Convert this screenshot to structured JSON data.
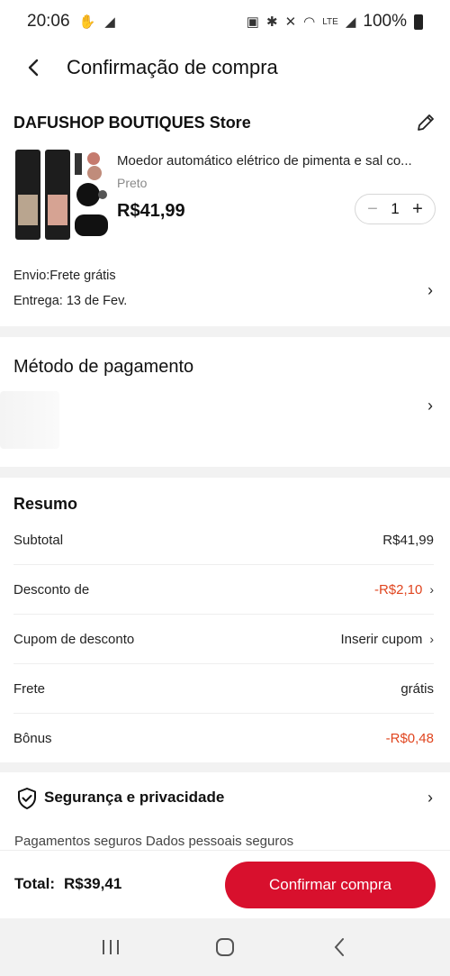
{
  "status_bar": {
    "time": "20:06",
    "battery_text": "100%"
  },
  "header": {
    "back_icon": "back-arrow-icon",
    "title": "Confirmação de compra"
  },
  "store": {
    "name": "DAFUSHOP BOUTIQUES Store",
    "edit_icon": "pencil-icon",
    "product": {
      "title": "Moedor automático elétrico de pimenta e sal co...",
      "variant": "Preto",
      "price": "R$41,99",
      "quantity": "1"
    },
    "shipping": {
      "line1": "Envio:Frete grátis",
      "line2": "Entrega: 13 de Fev."
    }
  },
  "payment": {
    "title": "Método de pagamento"
  },
  "summary": {
    "title": "Resumo",
    "rows": [
      {
        "label": "Subtotal",
        "value": "R$41,99"
      },
      {
        "label": "Desconto de",
        "value": "-R$2,10"
      },
      {
        "label": "Cupom de desconto",
        "value": "Inserir cupom"
      },
      {
        "label": "Frete",
        "value": "grátis"
      },
      {
        "label": "Bônus",
        "value": "-R$0,48"
      }
    ]
  },
  "security": {
    "title": "Segurança e privacidade",
    "subtitle": "Pagamentos seguros   Dados pessoais seguros"
  },
  "footer": {
    "total_label": "Total:",
    "total_value": "R$39,41",
    "confirm_label": "Confirmar compra"
  },
  "colors": {
    "accent": "#d8102d",
    "discount_text": "#e0451f"
  }
}
